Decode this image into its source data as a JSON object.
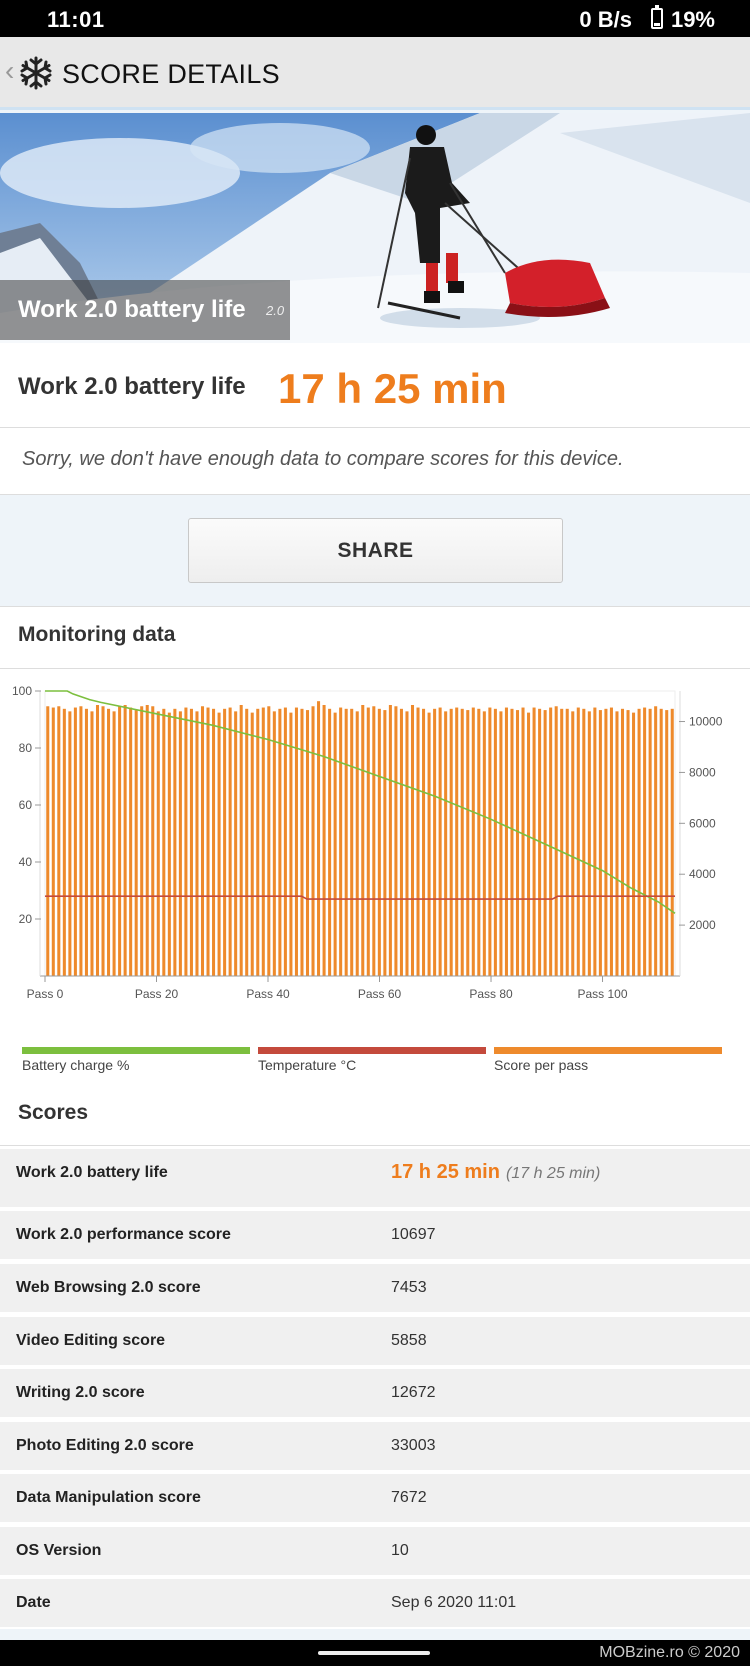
{
  "status_bar": {
    "time": "11:01",
    "network": "0 B/s",
    "battery": "19%"
  },
  "app_bar": {
    "back_glyph": "‹",
    "title": "SCORE DETAILS",
    "logo_icon": "snowflake-icon"
  },
  "hero": {
    "label": "Work 2.0 battery life",
    "version": "2.0"
  },
  "result": {
    "name": "Work 2.0 battery life",
    "value": "17 h 25 min",
    "compare_message": "Sorry, we don't have enough data to compare scores for this device."
  },
  "share": {
    "label": "SHARE"
  },
  "monitoring": {
    "title": "Monitoring data",
    "legend": [
      {
        "label": "Battery charge %",
        "color": "#7cbf3e"
      },
      {
        "label": "Temperature °C",
        "color": "#c44a3c"
      },
      {
        "label": "Score per pass",
        "color": "#ee8a2c"
      }
    ]
  },
  "chart_data": {
    "type": "bar",
    "x_tick_labels": [
      "Pass 0",
      "Pass 20",
      "Pass 40",
      "Pass 60",
      "Pass 80",
      "Pass 100"
    ],
    "x_ticks": [
      0,
      20,
      40,
      60,
      80,
      100
    ],
    "xlim": [
      0,
      113
    ],
    "left_axis": {
      "ticks": [
        20,
        40,
        60,
        80,
        100
      ],
      "ylim": [
        0,
        100
      ]
    },
    "right_axis": {
      "ticks": [
        2000,
        4000,
        6000,
        8000,
        10000
      ],
      "ylim": [
        0,
        11200
      ]
    },
    "series": [
      {
        "name": "Score per pass",
        "type": "bar",
        "axis": "right",
        "color": "#ee8a2c",
        "values": [
          10600,
          10550,
          10600,
          10500,
          10400,
          10550,
          10600,
          10500,
          10400,
          10650,
          10600,
          10500,
          10400,
          10600,
          10650,
          10550,
          10450,
          10600,
          10650,
          10600,
          10400,
          10500,
          10350,
          10500,
          10400,
          10550,
          10500,
          10400,
          10600,
          10550,
          10500,
          10350,
          10500,
          10550,
          10400,
          10650,
          10500,
          10350,
          10500,
          10550,
          10600,
          10400,
          10500,
          10550,
          10350,
          10550,
          10500,
          10450,
          10600,
          10800,
          10650,
          10500,
          10350,
          10550,
          10500,
          10500,
          10400,
          10650,
          10550,
          10600,
          10500,
          10450,
          10650,
          10600,
          10500,
          10400,
          10650,
          10550,
          10500,
          10350,
          10500,
          10550,
          10400,
          10500,
          10550,
          10500,
          10450,
          10550,
          10500,
          10400,
          10550,
          10500,
          10400,
          10550,
          10500,
          10450,
          10550,
          10350,
          10550,
          10500,
          10450,
          10550,
          10600,
          10500,
          10500,
          10400,
          10550,
          10500,
          10400,
          10550,
          10450,
          10500,
          10550,
          10400,
          10500,
          10450,
          10350,
          10500,
          10550,
          10500,
          10600,
          10500,
          10450,
          10500
        ]
      },
      {
        "name": "Battery charge %",
        "type": "line",
        "axis": "left",
        "color": "#7cbf3e",
        "points": [
          [
            0,
            100
          ],
          [
            4,
            100
          ],
          [
            5,
            99
          ],
          [
            8,
            97
          ],
          [
            10,
            96
          ],
          [
            20,
            92
          ],
          [
            30,
            88
          ],
          [
            40,
            83
          ],
          [
            50,
            77
          ],
          [
            60,
            70
          ],
          [
            70,
            63
          ],
          [
            80,
            55
          ],
          [
            90,
            46
          ],
          [
            100,
            37
          ],
          [
            105,
            31
          ],
          [
            110,
            26
          ],
          [
            113,
            22
          ]
        ]
      },
      {
        "name": "Temperature °C",
        "type": "line",
        "axis": "left",
        "color": "#c44a3c",
        "points": [
          [
            0,
            28
          ],
          [
            46,
            28
          ],
          [
            47,
            27
          ],
          [
            91,
            27
          ],
          [
            92,
            28
          ],
          [
            113,
            28
          ]
        ]
      }
    ]
  },
  "scores": {
    "title": "Scores",
    "primary": {
      "label": "Work 2.0 battery life",
      "value": "17 h 25 min",
      "secondary": "(17 h 25 min)"
    },
    "rows": [
      {
        "label": "Work 2.0 performance score",
        "value": "10697"
      },
      {
        "label": "Web Browsing 2.0 score",
        "value": "7453"
      },
      {
        "label": "Video Editing score",
        "value": "5858"
      },
      {
        "label": "Writing 2.0 score",
        "value": "12672"
      },
      {
        "label": "Photo Editing 2.0 score",
        "value": "33003"
      },
      {
        "label": "Data Manipulation score",
        "value": "7672"
      },
      {
        "label": "OS Version",
        "value": "10"
      },
      {
        "label": "Date",
        "value": "Sep 6 2020 11:01"
      }
    ]
  },
  "watermark": "MOBzine.ro © 2020"
}
